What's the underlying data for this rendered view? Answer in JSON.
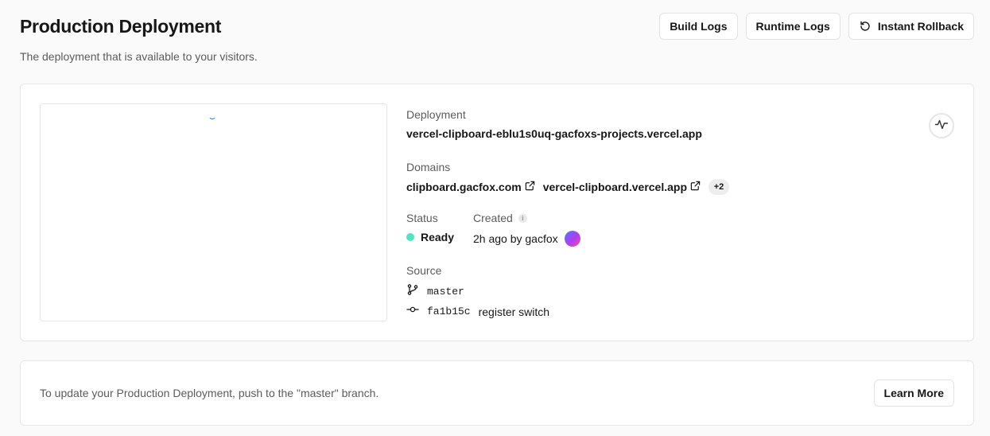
{
  "header": {
    "title": "Production Deployment",
    "subtitle": "The deployment that is available to your visitors.",
    "actions": {
      "build_logs": "Build Logs",
      "runtime_logs": "Runtime Logs",
      "instant_rollback": "Instant Rollback"
    }
  },
  "deployment": {
    "label": "Deployment",
    "url": "vercel-clipboard-eblu1s0uq-gacfoxs-projects.vercel.app"
  },
  "domains": {
    "label": "Domains",
    "items": [
      "clipboard.gacfox.com",
      "vercel-clipboard.vercel.app"
    ],
    "more": "+2"
  },
  "status": {
    "label": "Status",
    "value": "Ready",
    "color": "#50e3c2"
  },
  "created": {
    "label": "Created",
    "info_icon": "i",
    "value": "2h ago by gacfox"
  },
  "source": {
    "label": "Source",
    "branch": "master",
    "commit_hash": "fa1b15c",
    "commit_message": "register switch"
  },
  "footer": {
    "text": "To update your Production Deployment, push to the \"master\" branch.",
    "learn_more": "Learn More"
  },
  "icons": {
    "rollback": "rollback-icon",
    "external_link": "external-link-icon",
    "branch": "git-branch-icon",
    "commit": "git-commit-icon",
    "activity": "activity-icon"
  }
}
